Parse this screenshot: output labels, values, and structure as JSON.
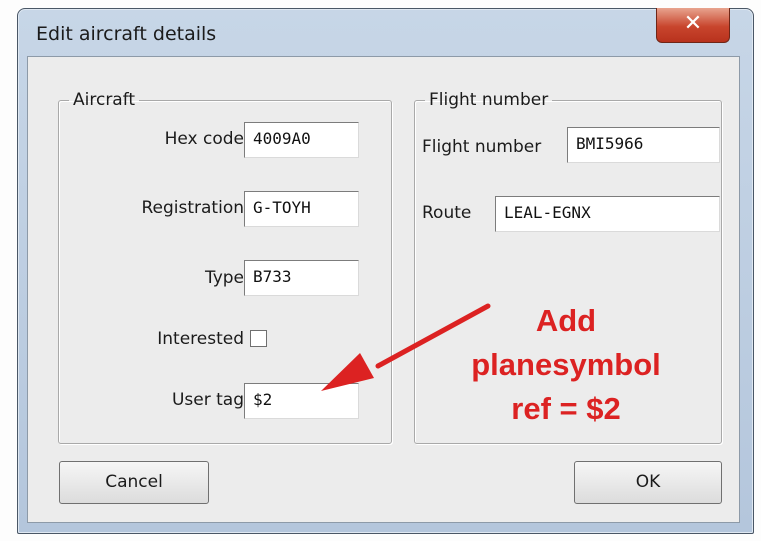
{
  "window": {
    "title": "Edit aircraft details",
    "close_glyph": "✕"
  },
  "aircraft_group": {
    "legend": "Aircraft",
    "hex_code": {
      "label": "Hex code",
      "value": "4009A0"
    },
    "registration": {
      "label": "Registration",
      "value": "G-TOYH"
    },
    "type": {
      "label": "Type",
      "value": "B733"
    },
    "interested": {
      "label": "Interested",
      "checked": false
    },
    "user_tag": {
      "label": "User tag",
      "value": "$2"
    }
  },
  "flight_group": {
    "legend": "Flight number",
    "flight_number": {
      "label": "Flight number",
      "value": "BMI5966"
    },
    "route": {
      "label": "Route",
      "value": "LEAL-EGNX"
    }
  },
  "buttons": {
    "cancel": "Cancel",
    "ok": "OK"
  },
  "annotation": {
    "line1": "Add",
    "line2": "planesymbol",
    "line3": "ref = $2",
    "color": "#dc2222"
  }
}
